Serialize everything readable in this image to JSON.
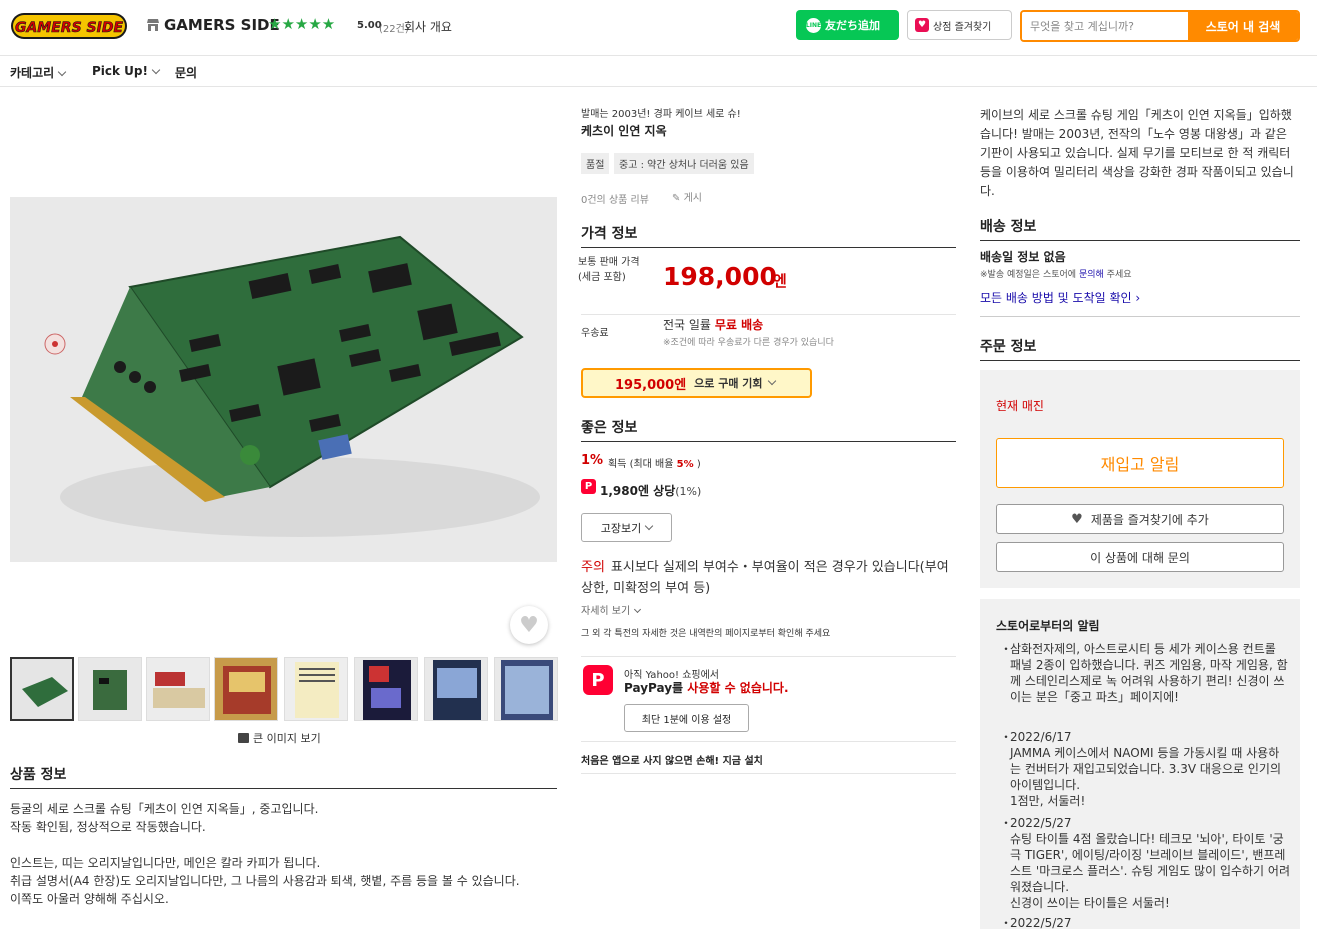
{
  "header": {
    "logo_text": "GAMERS SIDE",
    "store_name": "GAMERS SIDE",
    "stars": "★★★★★",
    "rating": "5.00",
    "review_count": "(22건)",
    "company_link": "회사 개요",
    "line_button": "友だち追加",
    "line_icon_text": "LINE",
    "fav_store_button": "상점 즐겨찾기",
    "search_placeholder": "무엇을 찾고 계십니까?",
    "search_button": "스토어 내 검색"
  },
  "nav": {
    "category": "카테고리",
    "pickup": "Pick Up!",
    "inquiry": "문의"
  },
  "gallery": {
    "large_image_link": "큰 이미지 보기",
    "thumbnail_count": 8
  },
  "product_info": {
    "title": "상품 정보",
    "paragraphs": [
      "등굴의 세로 스크롤 슈팅「케츠이 인연 지옥들」, 중고입니다.",
      "작동 확인됨, 정상적으로 작동했습니다.",
      "",
      "인스트는, 띠는 오리지날입니다만, 메인은 칼라 카피가 됩니다.",
      "취급 설명서(A4 한장)도 오리지날입니다만, 그 나름의 사용감과 퇴색, 햇볕, 주름 등을 볼 수 있습니다.",
      "이쪽도 아울러 양해해 주십시오."
    ]
  },
  "product": {
    "release_caption": "발매는 2003년! 경파 케이브 세로 슈!",
    "title": "케츠이 인연 지옥",
    "tags": [
      "품절",
      "중고 : 약간 상처나 더러움 있음"
    ],
    "review_link": "0건의 상품 리뷰",
    "post_link": "게시"
  },
  "price_section": {
    "title": "가격 정보",
    "list_price_label": "보통 판매 가격 (세금 포함)",
    "price": "198,000",
    "unit": "엔",
    "shipping_label": "우송료",
    "shipping_prefix": "전국 일률",
    "shipping_free": "무료 배송",
    "shipping_note": "※조건에 따라 우송료가 다른 경우가 있습니다",
    "coupon_price": "195,000엔",
    "coupon_text": "으로 구매 기회"
  },
  "good_info": {
    "title": "좋은 정보",
    "point_rate": "1%",
    "point_rate_text_prefix": "획득 (최대 배율",
    "point_rate_max": "5%",
    "point_rate_text_suffix": ")",
    "paypay_icon": "P",
    "paypay_points": "1,980엔 상당",
    "paypay_points_pct": "(1%)",
    "breakdown_button": "고장보기",
    "caution_label": "주의",
    "caution_text": "표시보다 실제의 부여수・부여율이 적은 경우가 있습니다(부여 상한, 미확정의 부여 등)",
    "details_link": "자세히 보기",
    "other_perks": "그 외 각 특전의 자세한 것은 내역란의 페이지로부터 확인해 주세요"
  },
  "paypay_box": {
    "line1": "아직 Yahoo! 쇼핑에서",
    "line2_prefix": "PayPay를",
    "line2_highlight": "사용할 수 없습니다.",
    "setup_button": "최단 1분에 이용 설정",
    "app_promo": "처음은 앱으로 사지 않으면 손해! 지금 설치"
  },
  "right": {
    "intro": "케이브의 세로 스크롤 슈팅 게임「케츠이 인연 지옥들」입하했습니다! 발매는 2003년, 전작의「노수 영봉 대왕생」과 같은 기판이 사용되고 있습니다. 실제 무기를 모티브로 한 적 캐릭터 등을 이용하여 밀리터리 색상을 강화한 경파 작품이되고 있습니다.",
    "delivery_title": "배송 정보",
    "no_delivery": "배송일 정보 없음",
    "delivery_note_prefix": "※발송 예정일은 스토어에",
    "delivery_note_link": "문의해",
    "delivery_note_suffix": "주세요",
    "delivery_methods": "모든 배송 방법 및 도착일 확인",
    "order_title": "주문 정보",
    "soldout": "현재 매진",
    "restock_button": "재입고 알림",
    "add_fav_button": "제품을 즐겨찾기에 추가",
    "inquiry_button": "이 상품에 대해 문의",
    "notice_title": "스토어로부터의 알림",
    "notices": [
      "삼화전자제의, 아스트로시티 등 세가 케이스용 컨트롤 패널 2종이 입하했습니다. 퀴즈 게임용, 마작 게임용, 함께 스테인리스제로 녹 어려워 사용하기 편리! 신경이 쓰이는 분은「중고 파츠」페이지에!",
      "2022/6/17\nJAMMA 케이스에서 NAOMI 등을 가동시킬 때 사용하는 컨버터가 재입고되었습니다. 3.3V 대응으로 인기의 아이템입니다.\n1점만, 서둘러!",
      "2022/5/27\n슈팅 타이틀 4점 올랐습니다! 테크모 '뇌아', 타이토 '궁극 TIGER', 에이팅/라이징 '브레이브 블레이드', 밴프레스트 '마크로스 플러스'. 슈팅 게임도 많이 입수하기 어려워졌습니다.\n신경이 쓰이는 타이틀은 서둘러!",
      "2022/5/27"
    ]
  },
  "colors": {
    "accent_orange": "#ff8a00",
    "price_red": "#d10000",
    "line_green": "#06c755",
    "star_green": "#27a844"
  }
}
